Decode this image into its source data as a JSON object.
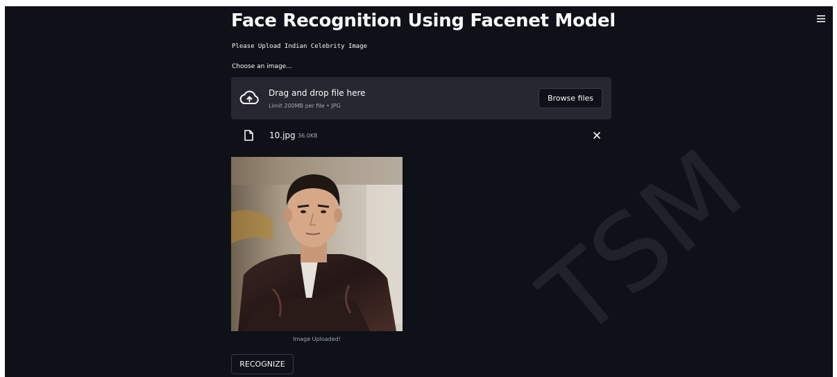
{
  "header": {
    "title": "Face Recognition Using Facenet Model",
    "subtitle": "Please Upload Indian Celebrity Image",
    "menu_icon": "hamburger-menu-icon"
  },
  "uploader": {
    "label": "Choose an image...",
    "instructions": "Drag and drop file here",
    "limit": "Limit 200MB per file • JPG",
    "browse_label": "Browse files",
    "upload_icon": "cloud-upload-icon"
  },
  "uploaded_file": {
    "name": "10.jpg",
    "size": "36.0KB",
    "file_icon": "file-icon",
    "remove_icon": "close-icon"
  },
  "image": {
    "caption": "Image Uploaded!"
  },
  "actions": {
    "recognize_label": "RECOGNIZE"
  },
  "watermark": {
    "text": "TSM"
  },
  "colors": {
    "background": "#0e1117",
    "panel": "#262730",
    "text": "#fafafa",
    "muted": "#a3a8b4"
  }
}
